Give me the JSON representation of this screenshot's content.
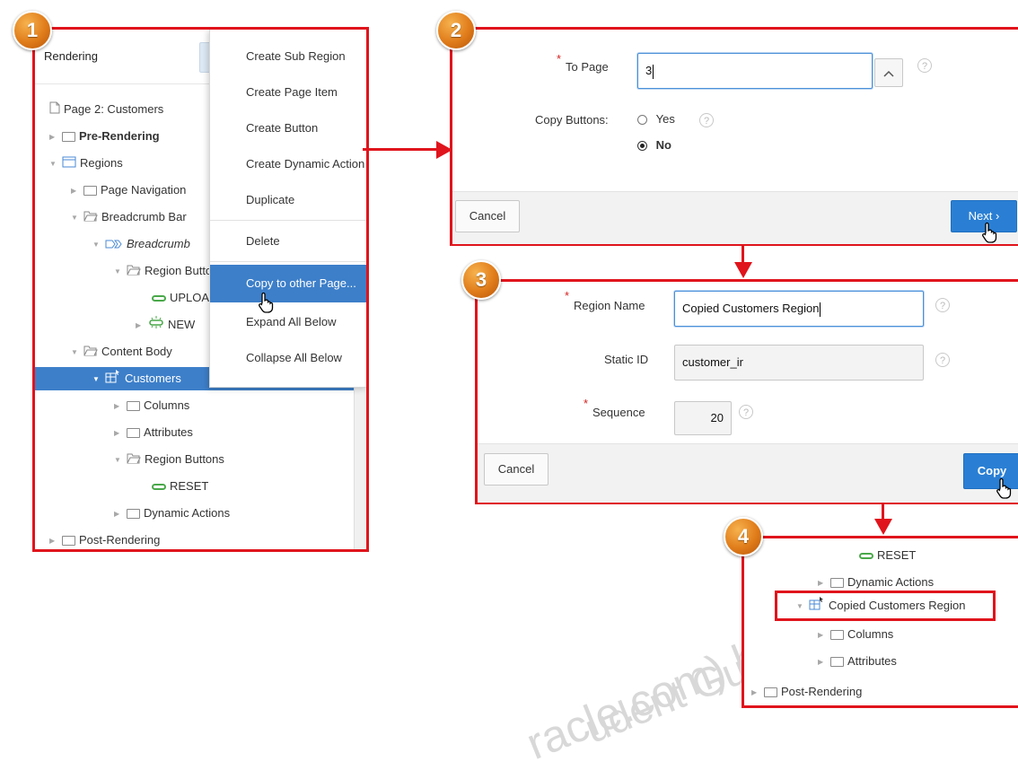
{
  "badges": [
    "1",
    "2",
    "3",
    "4"
  ],
  "panel1": {
    "header": "Rendering",
    "tree": [
      {
        "label": "Page 2: Customers",
        "icon": "page-icon",
        "expander": "none"
      },
      {
        "label": "Pre-Rendering",
        "icon": "folder-icon",
        "expander": "collapsed"
      },
      {
        "label": "Regions",
        "icon": "region-icon",
        "expander": "expanded"
      },
      {
        "label": "Page Navigation",
        "icon": "folder-icon",
        "expander": "collapsed"
      },
      {
        "label": "Breadcrumb Bar",
        "icon": "open-folder-icon",
        "expander": "expanded"
      },
      {
        "label": "Breadcrumb",
        "icon": "breadcrumb-icon",
        "expander": "expanded"
      },
      {
        "label": "Region Buttons",
        "icon": "open-folder-icon",
        "expander": "expanded"
      },
      {
        "label": "UPLOAD",
        "icon": "button-icon",
        "expander": "none"
      },
      {
        "label": "NEW",
        "icon": "new-button-icon",
        "expander": "collapsed"
      },
      {
        "label": "Content Body",
        "icon": "open-folder-icon",
        "expander": "expanded"
      },
      {
        "label": "Customers",
        "icon": "interactive-report-icon",
        "expander": "expanded"
      },
      {
        "label": "Columns",
        "icon": "folder-icon",
        "expander": "collapsed"
      },
      {
        "label": "Attributes",
        "icon": "folder-icon",
        "expander": "collapsed"
      },
      {
        "label": "Region Buttons",
        "icon": "open-folder-icon",
        "expander": "expanded"
      },
      {
        "label": "RESET",
        "icon": "button-icon",
        "expander": "none"
      },
      {
        "label": "Dynamic Actions",
        "icon": "folder-icon",
        "expander": "collapsed"
      },
      {
        "label": "Post-Rendering",
        "icon": "folder-icon",
        "expander": "collapsed"
      }
    ],
    "context_menu": [
      "Create Sub Region",
      "Create Page Item",
      "Create Button",
      "Create Dynamic Action",
      "Duplicate",
      "Delete",
      "Copy to other Page...",
      "Expand All Below",
      "Collapse All Below"
    ]
  },
  "panel2": {
    "to_page_label": "To Page",
    "to_page_value": "3",
    "stepper_icon": "chevron-up-icon",
    "copy_buttons_label": "Copy Buttons:",
    "options": [
      "Yes",
      "No"
    ],
    "selected_option": "No",
    "cancel": "Cancel",
    "next": "Next"
  },
  "panel3": {
    "region_name_label": "Region Name",
    "region_name_value": "Copied Customers Region",
    "static_id_label": "Static ID",
    "static_id_value": "customer_ir",
    "sequence_label": "Sequence",
    "sequence_value": "20",
    "cancel": "Cancel",
    "copy": "Copy"
  },
  "panel4": {
    "tree": [
      {
        "label": "RESET",
        "icon": "button-icon",
        "expander": "none"
      },
      {
        "label": "Dynamic Actions",
        "icon": "folder-icon",
        "expander": "collapsed"
      },
      {
        "label": "Copied Customers Region",
        "icon": "interactive-report-icon",
        "expander": "expanded"
      },
      {
        "label": "Columns",
        "icon": "folder-icon",
        "expander": "collapsed"
      },
      {
        "label": "Attributes",
        "icon": "folder-icon",
        "expander": "collapsed"
      },
      {
        "label": "Post-Rendering",
        "icon": "folder-icon",
        "expander": "collapsed"
      }
    ]
  },
  "watermark": {
    "line1": "racle.com) has a non-transferable",
    "line2": "udent Guide."
  },
  "colors": {
    "highlight": "#e0141c",
    "selection": "#3d7fc9",
    "primary": "#2a7fd4",
    "badge": "#e07c1a"
  }
}
